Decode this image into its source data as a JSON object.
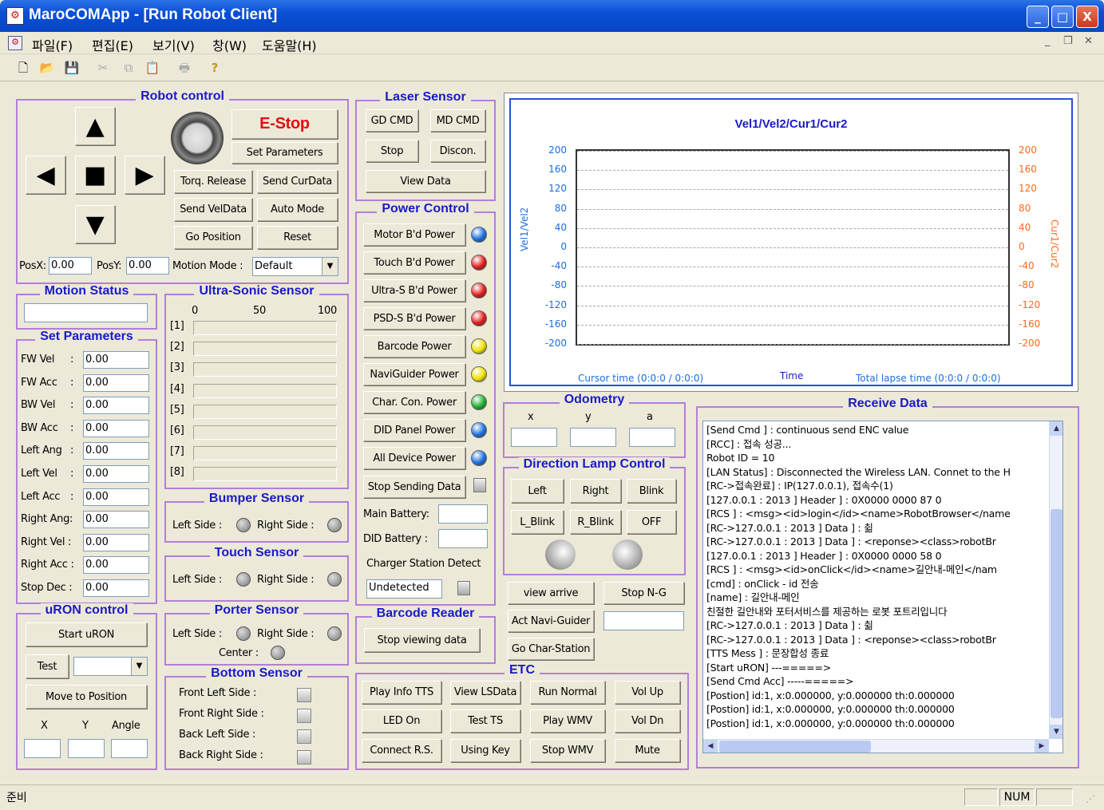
{
  "window": {
    "title": "MaroCOMApp - [Run Robot Client]",
    "min": "_",
    "max": "□",
    "close": "X"
  },
  "menu": {
    "items": [
      "파일(F)",
      "편집(E)",
      "보기(V)",
      "창(W)",
      "도움말(H)"
    ]
  },
  "robot_control": {
    "title": "Robot control",
    "estop": "E-Stop",
    "set_params": "Set Parameters",
    "torq_release": "Torq. Release",
    "send_curdata": "Send CurData",
    "send_veldata": "Send VelData",
    "auto_mode": "Auto Mode",
    "go_position": "Go Position",
    "reset": "Reset",
    "posx_label": "PosX:",
    "posx": "0.00",
    "posy_label": "PosY:",
    "posy": "0.00",
    "motion_mode_label": "Motion Mode :",
    "motion_mode": "Default"
  },
  "motion_status": {
    "title": "Motion Status",
    "value": ""
  },
  "set_parameters": {
    "title": "Set Parameters",
    "rows": [
      {
        "label": "FW Vel",
        "sep": ":",
        "value": "0.00"
      },
      {
        "label": "FW Acc",
        "sep": ":",
        "value": "0.00"
      },
      {
        "label": "BW Vel",
        "sep": ":",
        "value": "0.00"
      },
      {
        "label": "BW Acc",
        "sep": ":",
        "value": "0.00"
      },
      {
        "label": "Left Ang",
        "sep": ":",
        "value": "0.00"
      },
      {
        "label": "Left Vel",
        "sep": ":",
        "value": "0.00"
      },
      {
        "label": "Left Acc",
        "sep": ":",
        "value": "0.00"
      },
      {
        "label": "Right Ang:",
        "sep": "",
        "value": "0.00"
      },
      {
        "label": "Right Vel :",
        "sep": "",
        "value": "0.00"
      },
      {
        "label": "Right Acc :",
        "sep": "",
        "value": "0.00"
      },
      {
        "label": "Stop Dec :",
        "sep": "",
        "value": "0.00"
      }
    ]
  },
  "uron": {
    "title": "uRON control",
    "start": "Start uRON",
    "test": "Test",
    "test_value": "",
    "move": "Move to Position",
    "x": "X",
    "y": "Y",
    "angle": "Angle"
  },
  "ultrasonic": {
    "title": "Ultra-Sonic Sensor",
    "scale": [
      "0",
      "50",
      "100"
    ],
    "rows": [
      "[1]",
      "[2]",
      "[3]",
      "[4]",
      "[5]",
      "[6]",
      "[7]",
      "[8]"
    ]
  },
  "bumper": {
    "title": "Bumper Sensor",
    "left": "Left Side :",
    "right": "Right Side :"
  },
  "touch": {
    "title": "Touch Sensor",
    "left": "Left Side :",
    "right": "Right Side :"
  },
  "porter": {
    "title": "Porter Sensor",
    "left": "Left Side :",
    "right": "Right Side :",
    "center": "Center :"
  },
  "bottom": {
    "title": "Bottom Sensor",
    "rows": [
      "Front Left  Side  :",
      "Front Right  Side  :",
      "Back Left  Side  :",
      "Back Right  Side  :"
    ]
  },
  "laser": {
    "title": "Laser Sensor",
    "gd": "GD CMD",
    "md": "MD CMD",
    "stop": "Stop",
    "discon": "Discon.",
    "view": "View Data"
  },
  "power": {
    "title": "Power Control",
    "items": [
      {
        "label": "Motor B'd Power",
        "color": "#1a6fe0"
      },
      {
        "label": "Touch B'd Power",
        "color": "#e01a1a"
      },
      {
        "label": "Ultra-S B'd Power",
        "color": "#e01a1a"
      },
      {
        "label": "PSD-S B'd Power",
        "color": "#e01a1a"
      },
      {
        "label": "Barcode Power",
        "color": "#f0e000"
      },
      {
        "label": "NaviGuider Power",
        "color": "#f0e000"
      },
      {
        "label": "Char. Con. Power",
        "color": "#1ab02a"
      },
      {
        "label": "DID Panel Power",
        "color": "#1a6fe0"
      },
      {
        "label": "All Device Power",
        "color": "#1a6fe0"
      }
    ],
    "stop_sending": "Stop Sending Data",
    "main_battery": "Main Battery:",
    "main_battery_value": "",
    "did_battery": "DID Battery :",
    "did_battery_value": "",
    "charger": "Charger Station Detect",
    "charger_value": "Undetected"
  },
  "barcode": {
    "title": "Barcode Reader",
    "stop": "Stop viewing data"
  },
  "chart": {
    "title": "Vel1/Vel2/Cur1/Cur2",
    "ylabel_left": "Vel1/Vel2",
    "ylabel_right": "Cur1/Cur2",
    "xlabel": "Time",
    "cursor_time": "Cursor time (0:0:0 / 0:0:0)",
    "total_lapse": "Total lapse time (0:0:0 / 0:0:0)",
    "yticks": [
      "200",
      "160",
      "120",
      "80",
      "40",
      "0",
      "-40",
      "-80",
      "-120",
      "-160",
      "-200"
    ]
  },
  "chart_data": {
    "type": "line",
    "title": "Vel1/Vel2/Cur1/Cur2",
    "xlabel": "Time",
    "ylabel": "Vel1/Vel2",
    "y2label": "Cur1/Cur2",
    "ylim": [
      -200,
      200
    ],
    "y2lim": [
      -200,
      200
    ],
    "series": [],
    "grid": true
  },
  "odometry": {
    "title": "Odometry",
    "x": "x",
    "y": "y",
    "a": "a",
    "xv": "",
    "yv": "",
    "av": ""
  },
  "direction": {
    "title": "Direction Lamp Control",
    "left": "Left",
    "right": "Right",
    "blink": "Blink",
    "lblink": "L_Blink",
    "rblink": "R_Blink",
    "off": "OFF"
  },
  "nav": {
    "view_arrive": "view arrive",
    "stop_ng": "Stop N-G",
    "act_navi": "Act Navi-Guider",
    "go_char": "Go Char-Station",
    "field": ""
  },
  "etc": {
    "title": "ETC",
    "buttons": [
      "Play Info TTS",
      "View LSData",
      "Run Normal",
      "Vol Up",
      "LED On",
      "Test TS",
      "Play WMV",
      "Vol Dn",
      "Connect R.S.",
      "Using Key",
      "Stop WMV",
      "Mute"
    ]
  },
  "receive": {
    "title": "Receive Data",
    "lines": [
      "  [Send Cmd ] : continuous send ENC value",
      "  [RCC] : 접속 성공...",
      "Robot ID = 10",
      "  [LAN Status] : Disconnected the Wireless LAN. Connet to the H",
      "  [RC->접속완료] : IP(127.0.0.1), 접속수(1)",
      "  [127.0.0.1 : 2013 ] Header ] : 0X0000 0000 87 0",
      "  [RCS ] : <msg><id>login</id><name>RobotBrowser</name",
      "  [RC->127.0.0.1 : 2013 ] Data ] : 췲",
      "  [RC->127.0.0.1 : 2013 ] Data ] : <reponse><class>robotBr",
      "  [127.0.0.1 : 2013 ] Header ] : 0X0000 0000 58 0",
      "  [RCS ] : <msg><id>onClick</id><name>길안내-메인</nam",
      "  [cmd] : onClick - id 전송",
      "  [name] : 길안내-메인",
      "친절한 길안내와 포터서비스를 제공하는 로봇 포트리입니다",
      "  [RC->127.0.0.1 : 2013 ] Data ] : 췲",
      "  [RC->127.0.0.1 : 2013 ] Data ] : <reponse><class>robotBr",
      "  [TTS Mess ] : 문장합성 종료",
      "[Start uRON] ---=====>",
      "[Send Cmd Acc] -----=====>",
      "  [Postion] id:1, x:0.000000, y:0.000000 th:0.000000",
      "  [Postion] id:1, x:0.000000, y:0.000000 th:0.000000",
      "  [Postion] id:1, x:0.000000, y:0.000000 th:0.000000"
    ]
  },
  "status": {
    "text": "준비",
    "num": "NUM"
  }
}
